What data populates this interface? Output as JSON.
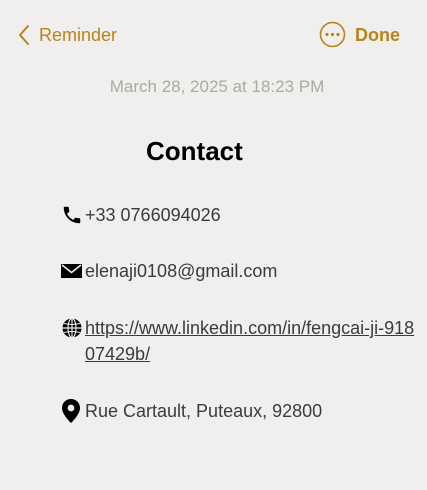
{
  "header": {
    "back_label": "Reminder",
    "done_label": "Done"
  },
  "note": {
    "timestamp": "March 28, 2025 at 18:23 PM",
    "title": "Contact",
    "phone": "+33 0766094026",
    "email": "elenaji0108@gmail.com",
    "website": "https://www.linkedin.com/in/fengcai-ji-91807429b/",
    "address": "Rue Cartault, Puteaux, 92800"
  },
  "colors": {
    "accent": "#b8841a",
    "background": "#f0efed",
    "timestamp": "#aaa9a6"
  },
  "icons": {
    "back": "chevron-left-icon",
    "more": "ellipsis-circle-icon",
    "phone": "phone-icon",
    "email": "envelope-icon",
    "web": "globe-icon",
    "address": "map-pin-icon"
  }
}
